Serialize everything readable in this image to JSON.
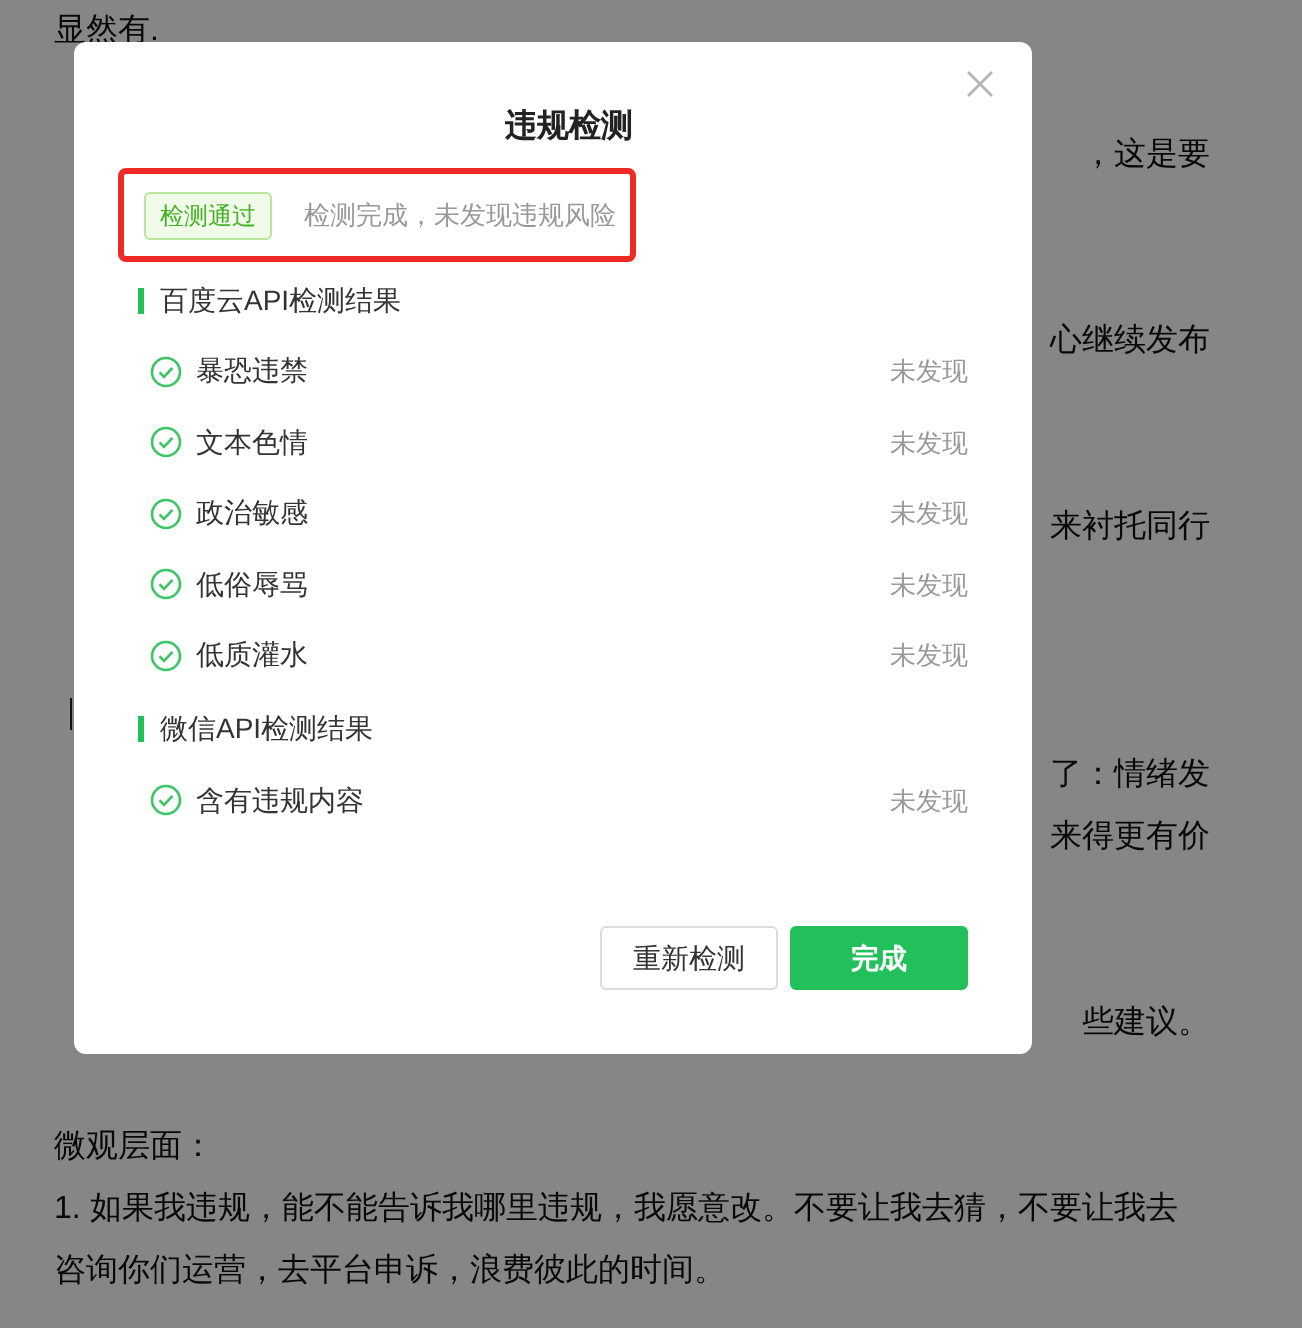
{
  "document": {
    "lines": [
      {
        "kind": "full",
        "text": "显然有."
      },
      {
        "kind": "gap"
      },
      {
        "kind": "tail",
        "text": "，这是要"
      },
      {
        "kind": "gap"
      },
      {
        "kind": "gap"
      },
      {
        "kind": "tail",
        "text": "心继续发布"
      },
      {
        "kind": "gap"
      },
      {
        "kind": "gap"
      },
      {
        "kind": "tail",
        "text": "来衬托同行"
      },
      {
        "kind": "gap"
      },
      {
        "kind": "gap"
      },
      {
        "kind": "caret"
      },
      {
        "kind": "tail",
        "text": "了：情绪发"
      },
      {
        "kind": "tail",
        "text": "来得更有价"
      },
      {
        "kind": "gap"
      },
      {
        "kind": "gap"
      },
      {
        "kind": "tail",
        "text": "些建议。"
      },
      {
        "kind": "gap"
      },
      {
        "kind": "full",
        "text": "微观层面："
      },
      {
        "kind": "full",
        "text": "1. 如果我违规，能不能告诉我哪里违规，我愿意改。不要让我去猜，不要让我去"
      },
      {
        "kind": "full",
        "text": "咨询你们运营，去平台申诉，浪费彼此的时间。"
      }
    ]
  },
  "dialog": {
    "title": "违规检测",
    "status": {
      "highlighted": true,
      "badge": "检测通过",
      "message": "检测完成，未发现违规风险"
    },
    "sections": [
      {
        "heading": "百度云API检测结果",
        "items": [
          {
            "label": "暴恐违禁",
            "result": "未发现",
            "passed": true
          },
          {
            "label": "文本色情",
            "result": "未发现",
            "passed": true
          },
          {
            "label": "政治敏感",
            "result": "未发现",
            "passed": true
          },
          {
            "label": "低俗辱骂",
            "result": "未发现",
            "passed": true
          },
          {
            "label": "低质灌水",
            "result": "未发现",
            "passed": true
          }
        ]
      },
      {
        "heading": "微信API检测结果",
        "items": [
          {
            "label": "含有违规内容",
            "result": "未发现",
            "passed": true
          }
        ]
      }
    ],
    "buttons": [
      {
        "label": "重新检测",
        "kind": "secondary"
      },
      {
        "label": "完成",
        "kind": "primary"
      }
    ]
  }
}
